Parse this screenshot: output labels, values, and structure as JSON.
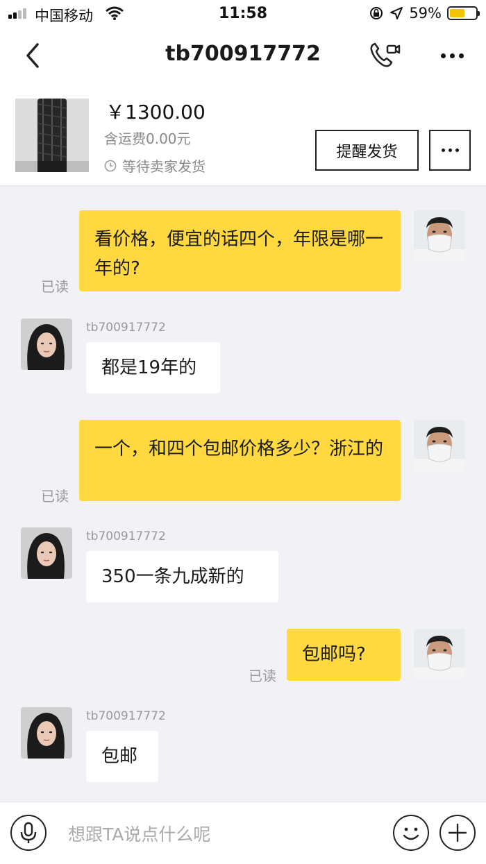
{
  "status_bar": {
    "carrier": "中国移动",
    "time": "11:58",
    "battery": "59%",
    "battery_level": 0.59
  },
  "nav": {
    "title": "tb700917772"
  },
  "order": {
    "price": "￥1300.00",
    "shipping": "含运费0.00元",
    "status": "等待卖家发货",
    "remind_label": "提醒发货"
  },
  "messages": [
    {
      "from": "me",
      "text": "看价格，便宜的话四个，年限是哪一年的?",
      "read": "已读"
    },
    {
      "from": "them",
      "sender": "tb700917772",
      "text": "都是19年的"
    },
    {
      "from": "me",
      "text": "一个，和四个包邮价格多少？浙江的",
      "read": "已读"
    },
    {
      "from": "them",
      "sender": "tb700917772",
      "text": "350一条九成新的"
    },
    {
      "from": "me",
      "text": "包邮吗?",
      "read": "已读"
    },
    {
      "from": "them",
      "sender": "tb700917772",
      "text": "包邮"
    }
  ],
  "input": {
    "placeholder": "想跟TA说点什么呢"
  },
  "colors": {
    "my_bubble": "#ffd93f",
    "their_bubble": "#ffffff",
    "background": "#f1f1f6"
  }
}
